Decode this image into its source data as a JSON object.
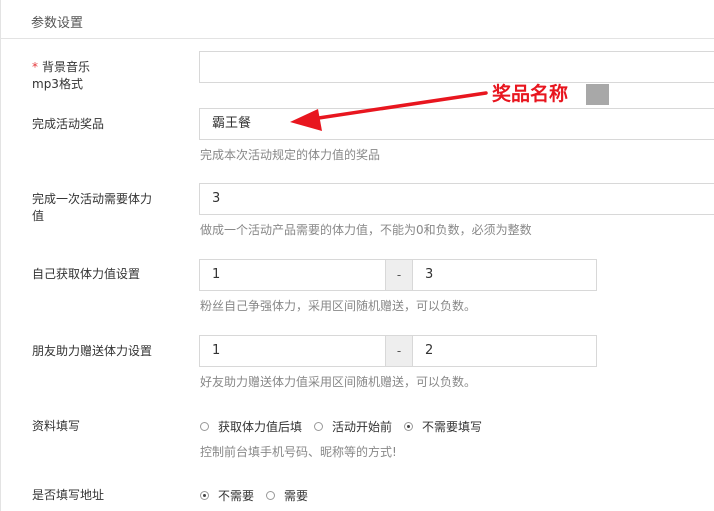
{
  "page": {
    "title": "参数设置"
  },
  "fields": {
    "bgm": {
      "required_mark": "*",
      "label": "背景音乐",
      "label_line2": "mp3格式",
      "value": ""
    },
    "prize": {
      "label": "完成活动奖品",
      "value": "霸王餐",
      "help": "完成本次活动规定的体力值的奖品"
    },
    "stamina_needed": {
      "label": "完成一次活动需要体力",
      "label_line2": "值",
      "value": "3",
      "help": "做成一个活动产品需要的体力值，不能为0和负数，必须为整数"
    },
    "self_stamina": {
      "label": "自己获取体力值设置",
      "min": "1",
      "separator": "-",
      "max": "3",
      "help": "粉丝自己争强体力，采用区间随机赠送，可以负数。"
    },
    "friend_stamina": {
      "label": "朋友助力赠送体力设置",
      "min": "1",
      "separator": "-",
      "max": "2",
      "help": "好友助力赠送体力值采用区间随机赠送，可以负数。"
    },
    "profile_fill": {
      "label": "资料填写",
      "options": [
        "获取体力值后填",
        "活动开始前",
        "不需要填写"
      ],
      "selected_index": 2,
      "help": "控制前台填手机号码、昵称等的方式!"
    },
    "address_fill": {
      "label": "是否填写地址",
      "options": [
        "不需要",
        "需要"
      ],
      "selected_index": 0
    }
  },
  "annotation": {
    "text": "奖品名称",
    "color": "#e8161f"
  }
}
